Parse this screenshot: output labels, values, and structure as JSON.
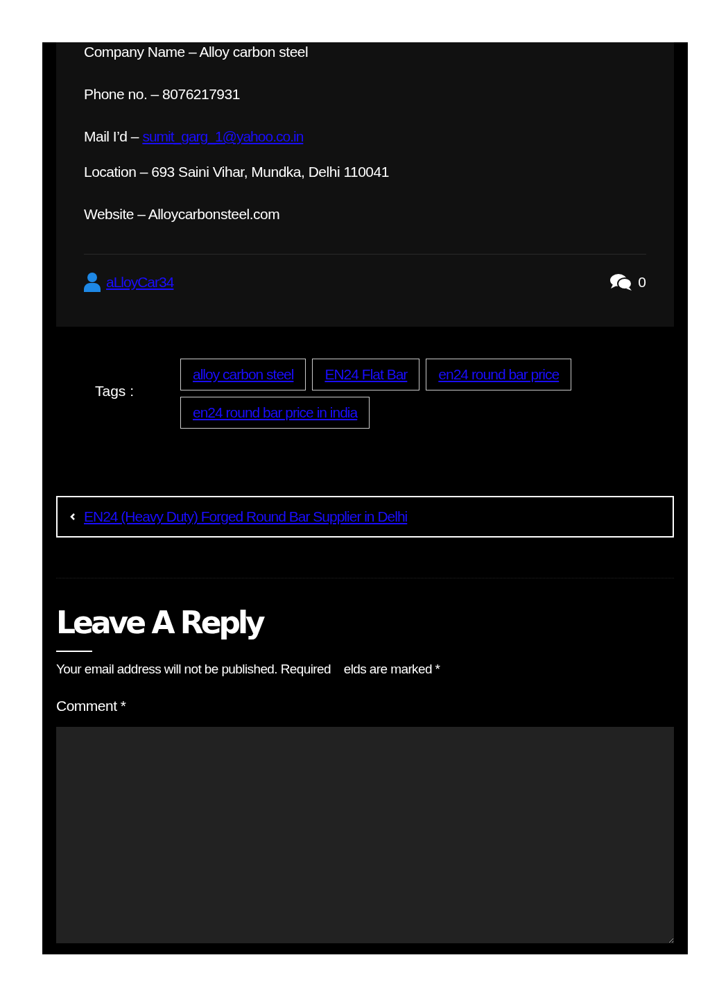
{
  "contact": [
    {
      "label": "Company Name – ",
      "value": "Alloy carbon steel",
      "kind": "text"
    },
    {
      "label": "Phone no. – ",
      "value": "8076217931",
      "kind": "text"
    },
    {
      "label": "Mail I’d – ",
      "value": "sumit_garg_1@yahoo.co.in",
      "kind": "link"
    },
    {
      "label": "Location – ",
      "value": "693 Saini Vihar, Mundka, Delhi 110041",
      "kind": "text"
    },
    {
      "label": "Website – ",
      "value": "Alloycarbonsteel.com",
      "kind": "text"
    }
  ],
  "author": "aLloyCar34",
  "comment_count": "0",
  "tags_label": "Tags :",
  "tags": [
    "alloy carbon steel",
    "EN24 Flat Bar",
    "en24 round bar price",
    "en24 round bar price in india"
  ],
  "prev_post": "EN24 (Heavy Duty) Forged Round Bar Supplier in Delhi",
  "reply": {
    "title": "Leave A Reply",
    "note": "Your email address will not be published. Required    elds are marked *",
    "comment_label": "Comment *"
  }
}
